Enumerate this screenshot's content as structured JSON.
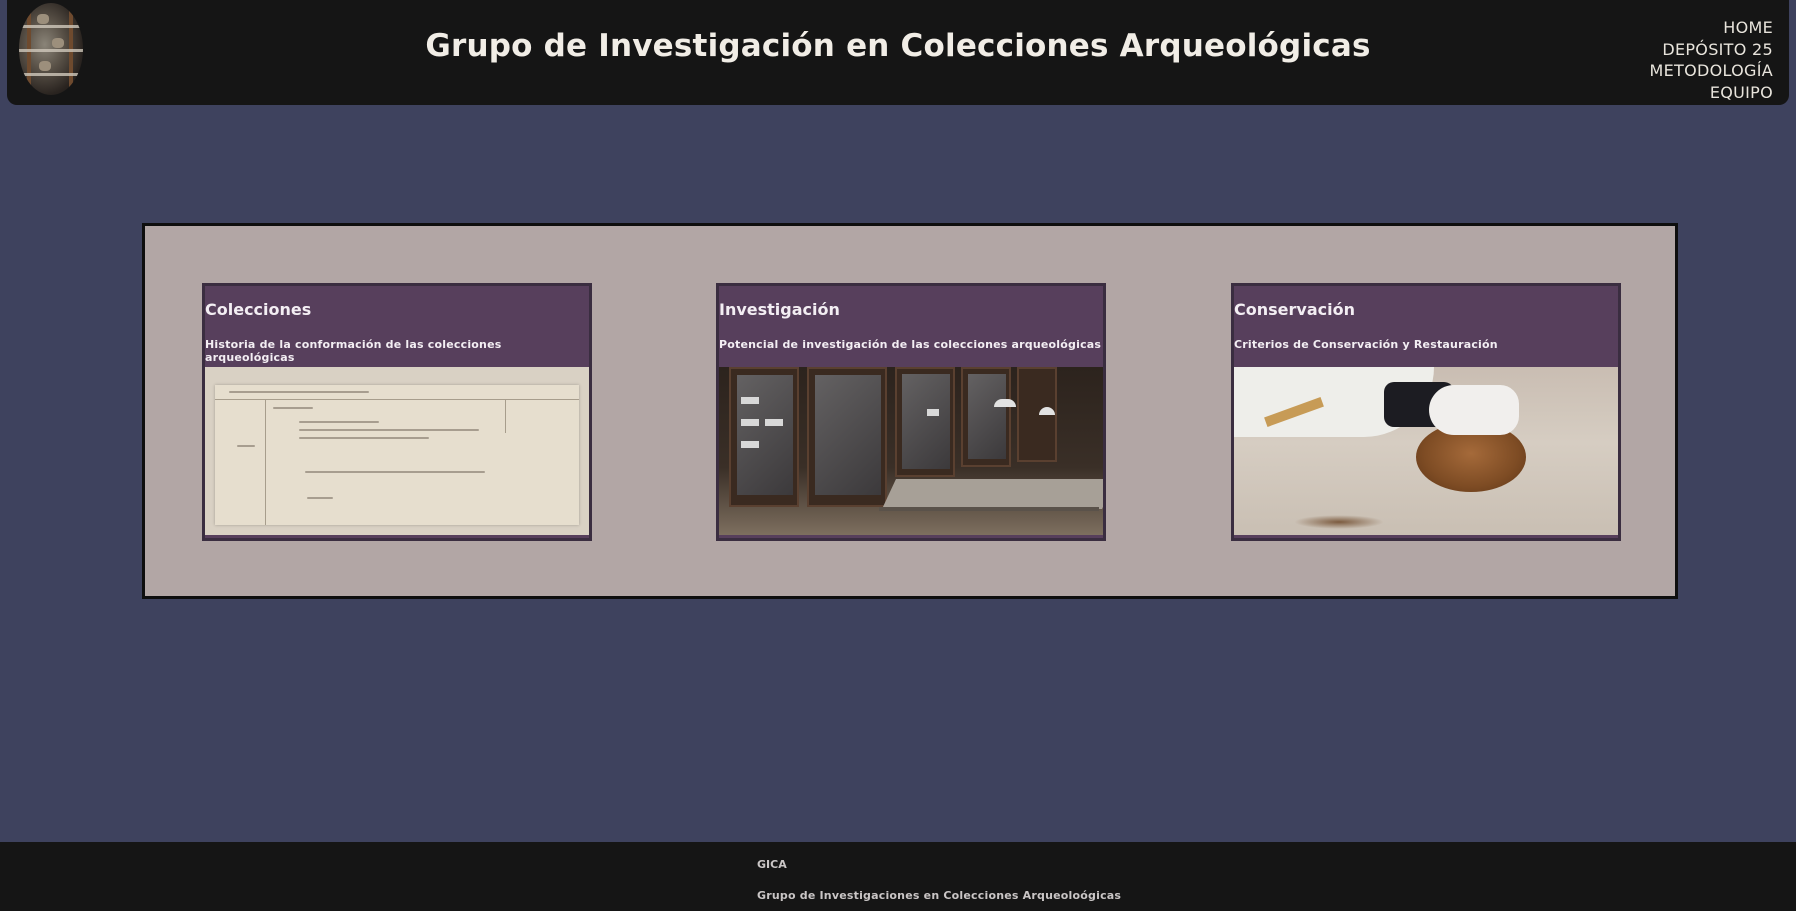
{
  "header": {
    "title": "Grupo de Investigación en Colecciones Arqueológicas",
    "nav": [
      "HOME",
      "DEPÓSITO 25",
      "METODOLOGÍA",
      "EQUIPO"
    ]
  },
  "cards": [
    {
      "title": "Colecciones",
      "subtitle": "Historia de la conformación de las colecciones arqueológicas"
    },
    {
      "title": "Investigación",
      "subtitle": "Potencial de investigación de las colecciones arqueológicas"
    },
    {
      "title": "Conservación",
      "subtitle": "Criterios de Conservación y Restauración"
    }
  ],
  "footer": {
    "title": "GICA",
    "subtitle": "Grupo de Investigaciones en Colecciones Arqueoloógicas"
  },
  "colors": {
    "page_bg": "#3e425e",
    "header_bg": "#151515",
    "panel_bg": "#b2a6a5",
    "card_bg": "#573f5c"
  }
}
